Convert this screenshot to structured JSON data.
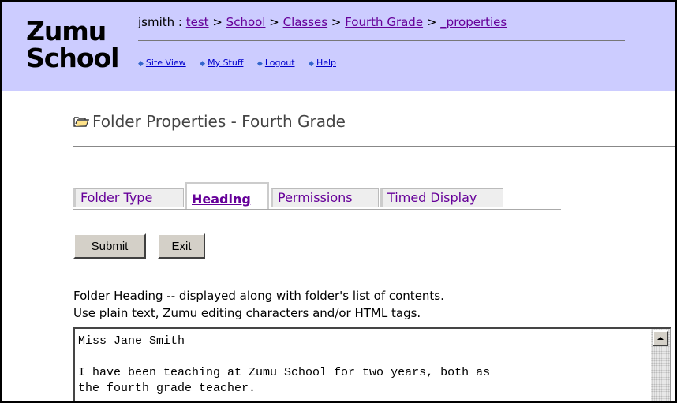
{
  "logo": {
    "line1": "Zumu",
    "line2": "School"
  },
  "breadcrumb": {
    "user": "jsmith",
    "sep1": " : ",
    "items": [
      "test",
      "School",
      "Classes",
      "Fourth Grade",
      "_properties"
    ],
    "sep": " > "
  },
  "nav": {
    "items": [
      "Site View",
      "My Stuff",
      "Logout",
      "Help"
    ],
    "bullet": "◆"
  },
  "page": {
    "title": "Folder Properties - Fourth Grade"
  },
  "tabs": [
    {
      "label": "Folder Type",
      "active": false
    },
    {
      "label": "Heading",
      "active": true
    },
    {
      "label": "Permissions",
      "active": false
    },
    {
      "label": "Timed Display",
      "active": false
    }
  ],
  "buttons": {
    "submit": "Submit",
    "exit": "Exit"
  },
  "description": {
    "line1": "Folder Heading -- displayed along with folder's list of contents.",
    "line2": "Use plain text, Zumu editing characters and/or HTML tags."
  },
  "heading_text": "Miss Jane Smith\n\nI have been teaching at Zumu School for two years, both as\nthe fourth grade teacher."
}
